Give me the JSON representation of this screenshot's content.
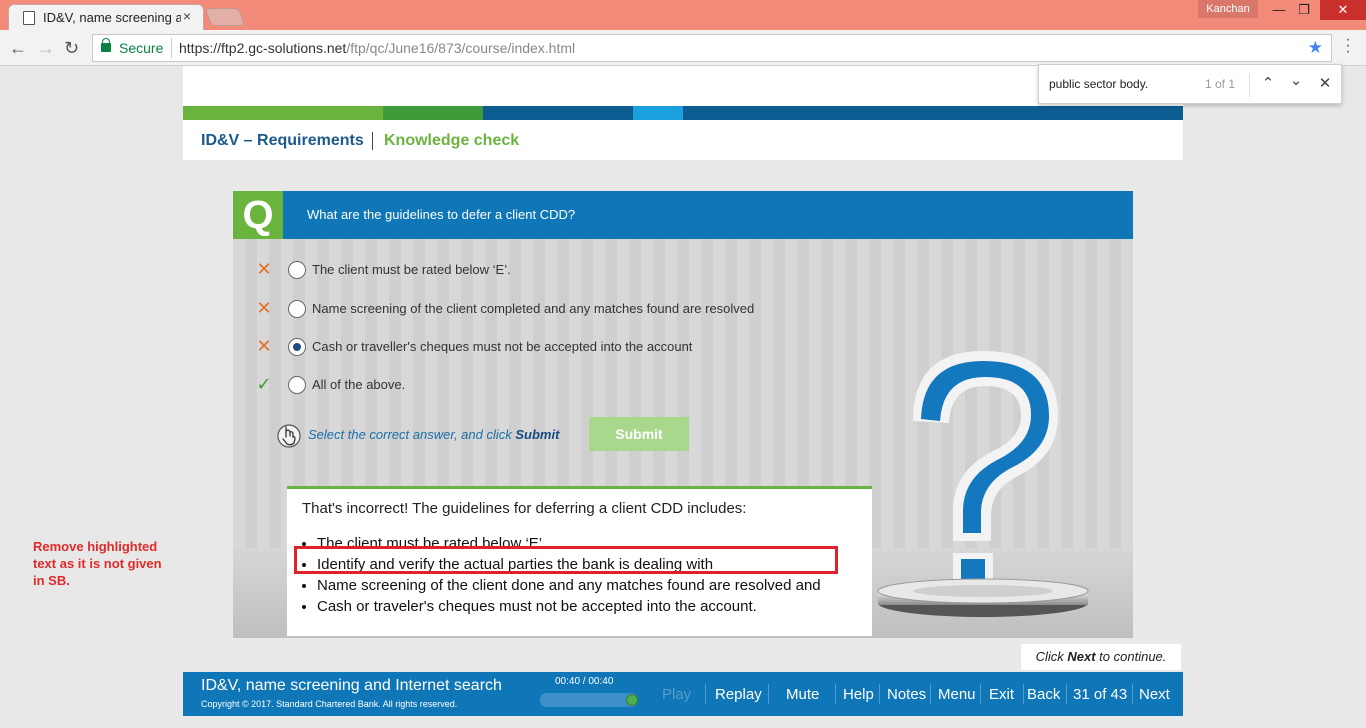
{
  "browser": {
    "tab_title": "ID&V, name screening ar",
    "tab_close": "×",
    "user": "Kanchan",
    "minimize": "—",
    "restore": "❐",
    "close": "✕",
    "secure_label": "Secure",
    "url_host": "https://ftp2.gc-solutions.net",
    "url_path": "/ftp/qc/June16/873/course/index.html"
  },
  "findbar": {
    "query": "public sector body.",
    "count": "1 of 1"
  },
  "course": {
    "header_title": "ID&V – Requirements",
    "header_sub": "Knowledge check",
    "accent_colors": [
      "#6ab43e",
      "#3f9a3a",
      "#0d5c91",
      "#1aa0dc"
    ],
    "question": {
      "badge": "Q",
      "text": "What are the guidelines to defer a client CDD?"
    },
    "options": [
      {
        "mark": "✕",
        "status": "wrong",
        "selected": false,
        "label": "The client must be rated below ‘E’."
      },
      {
        "mark": "✕",
        "status": "wrong",
        "selected": false,
        "label": "Name screening of the client completed and any matches found are resolved"
      },
      {
        "mark": "✕",
        "status": "wrong",
        "selected": true,
        "label": "Cash or traveller's cheques must not be accepted into the account"
      },
      {
        "mark": "✓",
        "status": "right",
        "selected": false,
        "label": "All of the above."
      }
    ],
    "instruction_prefix": "Select the correct answer, and click ",
    "instruction_action": "Submit",
    "submit_label": "Submit",
    "feedback": {
      "title": "That's incorrect! The guidelines for deferring a client CDD includes:",
      "items": [
        "The client must be rated below ‘E’.",
        "Identify and verify the actual parties the bank is dealing with",
        "Name screening of the client done and any matches found are resolved and",
        "Cash or traveler's cheques must not be accepted into the account."
      ]
    },
    "click_next_prefix": "Click ",
    "click_next_action": "Next",
    "click_next_suffix": " to continue."
  },
  "footer": {
    "title": "ID&V, name screening and Internet search",
    "copyright": "Copyright © 2017. Standard Chartered Bank. All rights reserved.",
    "time": "00:40 / 00:40",
    "progress": 1.0,
    "nav": {
      "play": "Play",
      "replay": "Replay",
      "mute": "Mute",
      "help": "Help",
      "notes": "Notes",
      "menu": "Menu",
      "exit": "Exit",
      "back": "Back",
      "page": "31 of 43",
      "next": "Next"
    }
  },
  "annotation": {
    "text": "Remove highlighted text as it is not given in SB."
  }
}
